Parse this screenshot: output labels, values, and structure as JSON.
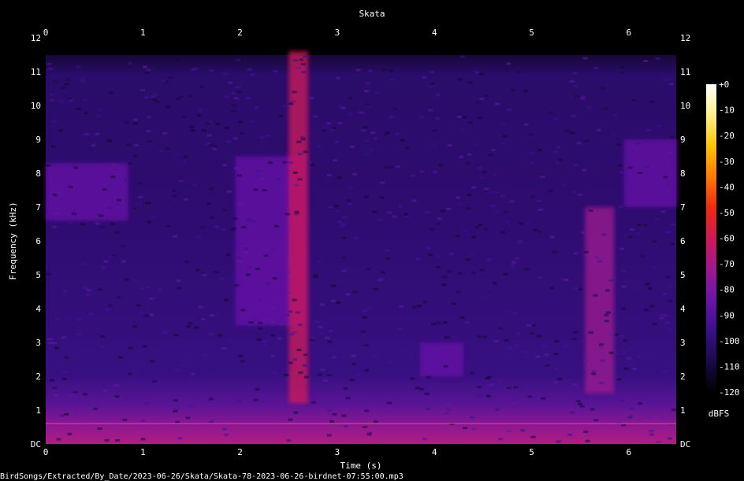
{
  "chart_data": {
    "type": "heatmap",
    "title": "Skata",
    "xlabel": "Time (s)",
    "ylabel": "Frequency (kHz)",
    "xlim": [
      0,
      6.5
    ],
    "ylim": [
      0,
      12
    ],
    "x_ticks": [
      "0",
      "1",
      "2",
      "3",
      "4",
      "5",
      "6"
    ],
    "y_ticks": [
      "DC",
      "1",
      "2",
      "3",
      "4",
      "5",
      "6",
      "7",
      "8",
      "9",
      "10",
      "11",
      "12"
    ],
    "colorbar": {
      "label": "dBFS",
      "range": [
        -120,
        0
      ],
      "ticks": [
        "+0",
        "-10",
        "-20",
        "-30",
        "-40",
        "-50",
        "-60",
        "-70",
        "-80",
        "-90",
        "-100",
        "-110",
        "-120"
      ],
      "colors": [
        "#000000",
        "#1a0a4a",
        "#3a108a",
        "#6a14a8",
        "#a01890",
        "#d01858",
        "#f02a10",
        "#ff7a00",
        "#ffc400",
        "#fff08a",
        "#ffffff"
      ]
    },
    "events": [
      {
        "t_start": 0.0,
        "t_end": 0.85,
        "f_low": 6.6,
        "f_high": 8.3,
        "level_dbfs": -85
      },
      {
        "t_start": 1.95,
        "t_end": 2.7,
        "f_low": 3.5,
        "f_high": 8.5,
        "level_dbfs": -80
      },
      {
        "t_start": 2.5,
        "t_end": 2.7,
        "f_low": 1.2,
        "f_high": 11.6,
        "level_dbfs": -65
      },
      {
        "t_start": 3.85,
        "t_end": 4.3,
        "f_low": 2.0,
        "f_high": 3.0,
        "level_dbfs": -85
      },
      {
        "t_start": 5.55,
        "t_end": 5.85,
        "f_low": 1.5,
        "f_high": 7.0,
        "level_dbfs": -75
      },
      {
        "t_start": 5.95,
        "t_end": 6.5,
        "f_low": 7.0,
        "f_high": 9.0,
        "level_dbfs": -90
      }
    ]
  },
  "footer": {
    "filepath": "BirdSongs/Extracted/By_Date/2023-06-26/Skata/Skata-78-2023-06-26-birdnet-07:55:00.mp3"
  }
}
